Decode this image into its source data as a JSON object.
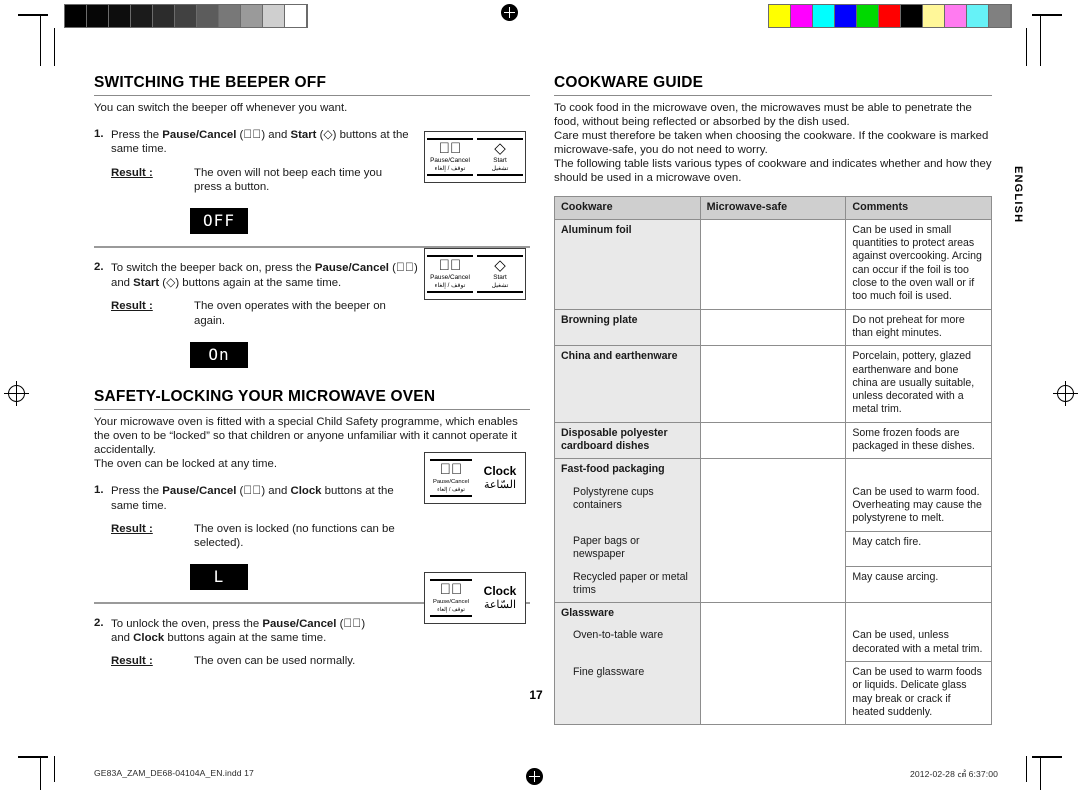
{
  "calibration": {
    "grey_swatches": [
      "#000000",
      "#060606",
      "#0d0d0d",
      "#1b1b1b",
      "#2c2c2c",
      "#414141",
      "#5c5c5c",
      "#787878",
      "#9a9a9a",
      "#cfcfcf",
      "#ffffff"
    ],
    "color_swatches": [
      "#ffff00",
      "#ff00ff",
      "#00ffff",
      "#0000ff",
      "#00d900",
      "#ff0000",
      "#000000",
      "#fff799",
      "#ff7bf0",
      "#66f2f7",
      "#808080"
    ]
  },
  "side_tab": "ENGLISH",
  "page_number": "17",
  "left_column": {
    "section1": {
      "title": "SWITCHING THE BEEPER OFF",
      "intro": "You can switch the beeper off whenever you want.",
      "step1": {
        "num": "1.",
        "text_before": "Press the ",
        "bold1": "Pause/Cancel",
        "text_mid1": " (",
        "sym1": "ⓧ",
        "text_mid2": ") and ",
        "bold2": "Start",
        "text_mid3": " (",
        "sym2": "◇",
        "text_after": ") buttons at the same time.",
        "result_label": "Result :",
        "result_text": "The oven will not beep each time you press a button.",
        "display": "OFF"
      },
      "step2": {
        "num": "2.",
        "text_before": "To switch the beeper back on, press the ",
        "bold1": "Pause/Cancel",
        "text_mid1": " (",
        "text_mid2": ") and ",
        "bold2": "Start",
        "text_after": ") buttons again at the same time.",
        "result_label": "Result :",
        "result_text": "The oven operates with the beeper on again.",
        "display": "On"
      }
    },
    "section2": {
      "title": "SAFETY-LOCKING YOUR MICROWAVE OVEN",
      "intro_line1": "Your microwave oven is fitted with a special Child Safety programme, which enables the oven to be “locked” so that children or anyone unfamiliar with it cannot operate it accidentally.",
      "intro_line2": "The oven can be locked at any time.",
      "step1": {
        "num": "1.",
        "text_before": "Press the ",
        "bold1": "Pause/Cancel",
        "text_mid1": " (",
        "text_mid2": ") and ",
        "bold2": "Clock",
        "text_after": " buttons at the same time.",
        "result_label": "Result :",
        "result_text": "The oven is locked (no functions can be selected).",
        "display": "L"
      },
      "step2": {
        "num": "2.",
        "text_before": "To unlock the oven, press the ",
        "bold1": "Pause/Cancel",
        "text_mid1": " (",
        "text_mid2": ") and ",
        "bold2": "Clock",
        "text_after": " buttons again at the same time.",
        "result_label": "Result :",
        "result_text": "The oven can be used normally."
      }
    },
    "panels": {
      "pause_cancel_en": "Pause/Cancel",
      "pause_cancel_ar": "توقف / إلغاء",
      "pause_cancel_glyph": "ⓧ",
      "start_en": "Start",
      "start_ar": "تشغيل",
      "start_glyph": "◇",
      "clock_en": "Clock",
      "clock_ar": "السّاعة"
    }
  },
  "right_column": {
    "title": "COOKWARE GUIDE",
    "intro_p1": "To cook food in the microwave oven, the microwaves must be able to penetrate the food, without being reflected or absorbed by the dish used.",
    "intro_p2": "Care must therefore be taken when choosing the cookware. If the cookware is marked microwave-safe, you do not need to worry.",
    "intro_p3": "The following table lists various types of cookware and indicates whether and how they should be used in a microwave oven.",
    "table": {
      "headers": [
        "Cookware",
        "Microwave-safe",
        "Comments"
      ],
      "rows": [
        {
          "cookware": "Aluminum foil",
          "safe": "",
          "comments": "Can be used in small quantities to protect areas against overcooking. Arcing can occur if the foil is too close to the oven wall or if too much foil is used."
        },
        {
          "cookware": "Browning plate",
          "safe": "",
          "comments": "Do not preheat for more than eight minutes."
        },
        {
          "cookware": "China and earthenware",
          "safe": "",
          "comments": "Porcelain, pottery, glazed earthenware and bone china are usually suitable, unless decorated with a metal trim."
        },
        {
          "cookware": "Disposable polyester cardboard dishes",
          "safe": "",
          "comments": "Some frozen foods are packaged in these dishes."
        },
        {
          "cookware": "Fast-food packaging",
          "safe": "",
          "comments": ""
        },
        {
          "cookware": "Polystyrene cups containers",
          "indent": true,
          "safe": "",
          "comments": "Can be used to warm food. Overheating may cause the polystyrene to melt."
        },
        {
          "cookware": "Paper bags or newspaper",
          "indent": true,
          "safe": "",
          "comments": "May catch fire."
        },
        {
          "cookware": "Recycled paper or metal trims",
          "indent": true,
          "safe": "",
          "comments": "May cause arcing."
        },
        {
          "cookware": "Glassware",
          "safe": "",
          "comments": ""
        },
        {
          "cookware": "Oven-to-table ware",
          "indent": true,
          "safe": "",
          "comments": "Can be used, unless decorated with a metal trim."
        },
        {
          "cookware": "Fine glassware",
          "indent": true,
          "safe": "",
          "comments": "Can be used to warm foods or liquids. Delicate glass may break or crack if heated suddenly."
        }
      ]
    }
  },
  "footer": {
    "file_name": "GE83A_ZAM_DE68-04104A_EN.indd   17",
    "timestamp": "2012-02-28   ㎠ 6:37:00"
  }
}
